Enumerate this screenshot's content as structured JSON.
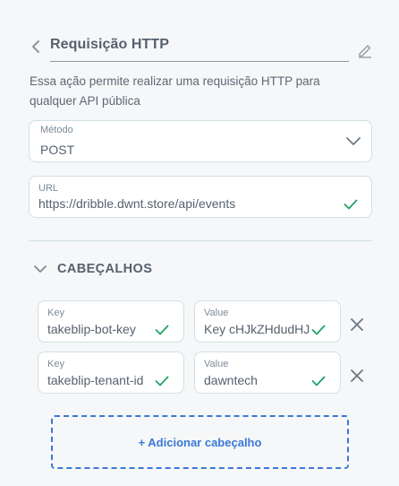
{
  "header": {
    "title": "Requisição HTTP",
    "description": "Essa ação permite realizar uma requisição HTTP para qualquer API pública"
  },
  "method": {
    "label": "Método",
    "value": "POST"
  },
  "url": {
    "label": "URL",
    "value": "https://dribble.dwnt.store/api/events"
  },
  "headers_section": {
    "title": "CABEÇALHOS",
    "key_label": "Key",
    "value_label": "Value",
    "rows": [
      {
        "key": "takeblip-bot-key",
        "value": "Key cHJkZHdudHJ"
      },
      {
        "key": "takeblip-tenant-id",
        "value": "dawntech"
      }
    ],
    "add_label": "+ Adicionar cabeçalho"
  },
  "colors": {
    "accent": "#3a78d8",
    "success": "#21a366",
    "text": "#56616e",
    "border": "#d2dfe6"
  },
  "icons": [
    "chevron-left-icon",
    "pencil-icon",
    "chevron-down-icon",
    "check-icon",
    "close-icon"
  ]
}
